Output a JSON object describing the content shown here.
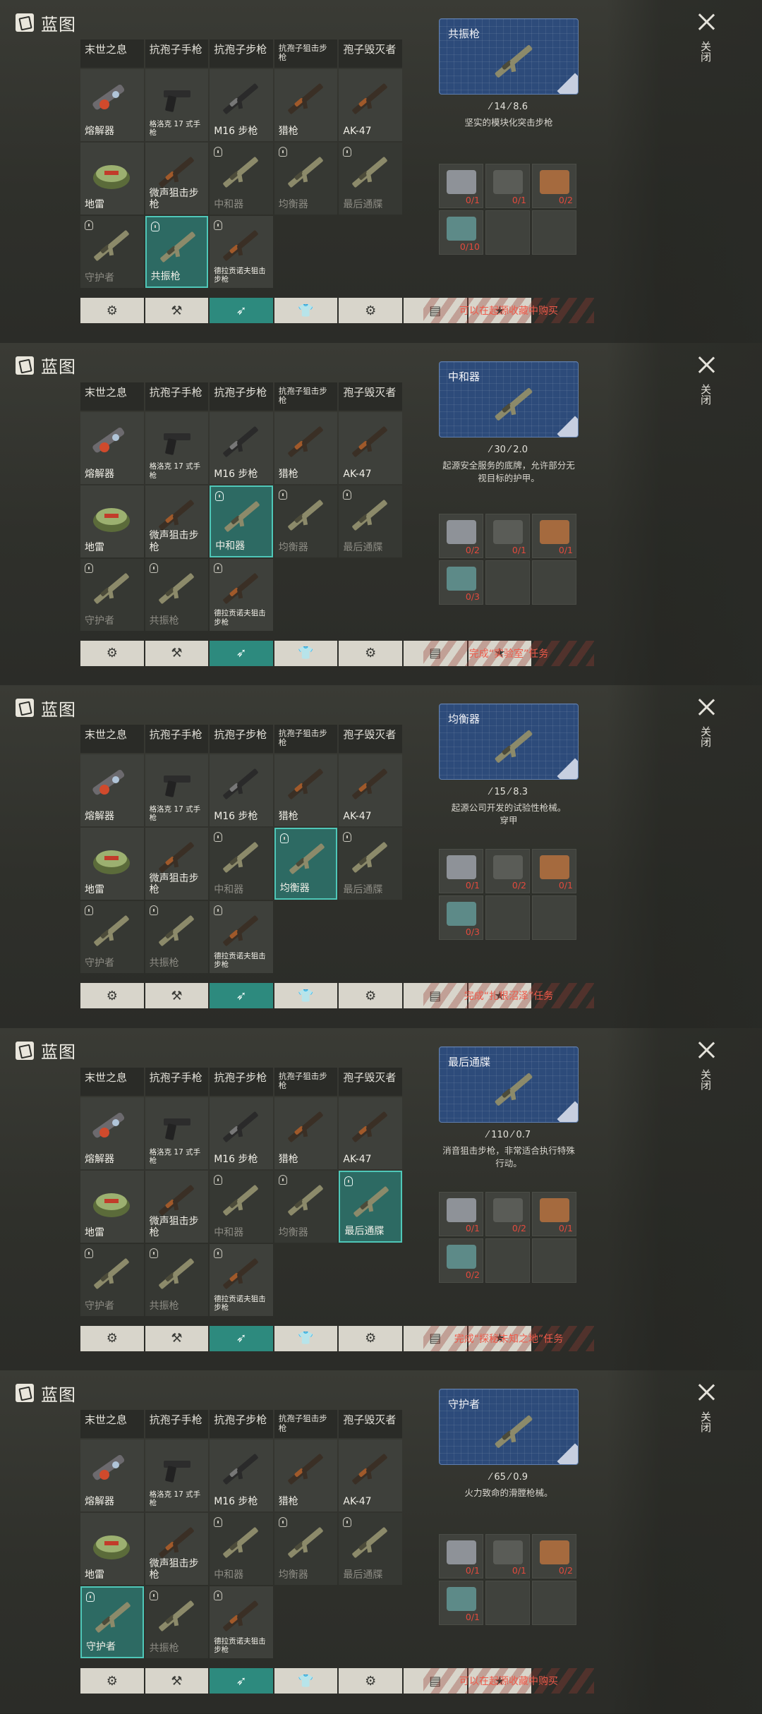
{
  "header_title": "蓝图",
  "close_label": "关闭",
  "categories": [
    "末世之息",
    "抗孢子手枪",
    "抗孢子步枪",
    "抗孢子狙击步枪",
    "孢子毁灭者"
  ],
  "weapons": [
    "熔解器",
    "格洛克 17 式手枪",
    "M16 步枪",
    "猎枪",
    "AK-47",
    "地雷",
    "微声狙击步枪",
    "中和器",
    "均衡器",
    "最后通牒",
    "守护者",
    "共振枪",
    "德拉贡诺夫狙击步枪"
  ],
  "tab_icons": [
    "blueprint-tool-icon",
    "axe-icon",
    "rifle-icon",
    "shirt-icon",
    "gear-icon",
    "crate-icon",
    "star-icon"
  ],
  "panels": [
    {
      "selected_index": 11,
      "detail": {
        "name": "共振枪",
        "stat_a": "14",
        "stat_b": "8.6",
        "desc": "坚实的模块化突击步枪"
      },
      "mats": [
        {
          "icon": "metal-plate-icon",
          "count": "0/1"
        },
        {
          "icon": "scrap-pile-icon",
          "count": "0/1"
        },
        {
          "icon": "plank-icon",
          "count": "0/2"
        },
        {
          "icon": "wire-coil-icon",
          "count": "0/10"
        }
      ],
      "unlock": "可以在起源收藏中购买"
    },
    {
      "selected_index": 7,
      "detail": {
        "name": "中和器",
        "stat_a": "30",
        "stat_b": "2.0",
        "desc": "起源安全服务的底牌，允许部分无视目标的护甲。"
      },
      "mats": [
        {
          "icon": "yellow-roll-icon",
          "count": "0/2"
        },
        {
          "icon": "red-canister-icon",
          "count": "0/1"
        },
        {
          "icon": "silver-ingot-icon",
          "count": "0/1"
        },
        {
          "icon": "spring-icon",
          "count": "0/3"
        }
      ],
      "unlock": "完成“实验室”任务"
    },
    {
      "selected_index": 8,
      "detail": {
        "name": "均衡器",
        "stat_a": "15",
        "stat_b": "8.3",
        "desc": "起源公司开发的试验性枪械。\n穿甲"
      },
      "mats": [
        {
          "icon": "crystal-icon",
          "count": "0/1"
        },
        {
          "icon": "red-canister-icon",
          "count": "0/2"
        },
        {
          "icon": "circuit-board-icon",
          "count": "0/1"
        },
        {
          "icon": "plank-icon",
          "count": "0/3"
        }
      ],
      "unlock": "完成“扎根沼泽”任务"
    },
    {
      "selected_index": 9,
      "detail": {
        "name": "最后通牒",
        "stat_a": "110",
        "stat_b": "0.7",
        "desc": "消音狙击步枪，非常适合执行特殊行动。"
      },
      "mats": [
        {
          "icon": "metal-plate-icon",
          "count": "0/1"
        },
        {
          "icon": "black-sheet-icon",
          "count": "0/2"
        },
        {
          "icon": "lens-icon",
          "count": "0/1"
        },
        {
          "icon": "scrap-pile-icon",
          "count": "0/2"
        }
      ],
      "unlock": "完成“探秘未知之地”任务"
    },
    {
      "selected_index": 10,
      "detail": {
        "name": "守护者",
        "stat_a": "65",
        "stat_b": "0.9",
        "desc": "火力致命的滑膛枪械。"
      },
      "mats": [
        {
          "icon": "electronics-icon",
          "count": "0/1"
        },
        {
          "icon": "scrap-pile-icon",
          "count": "0/1"
        },
        {
          "icon": "plank-icon",
          "count": "0/2"
        },
        {
          "icon": "black-sheet-icon",
          "count": "0/1"
        }
      ],
      "unlock": "可以在起源收藏中购买"
    }
  ]
}
